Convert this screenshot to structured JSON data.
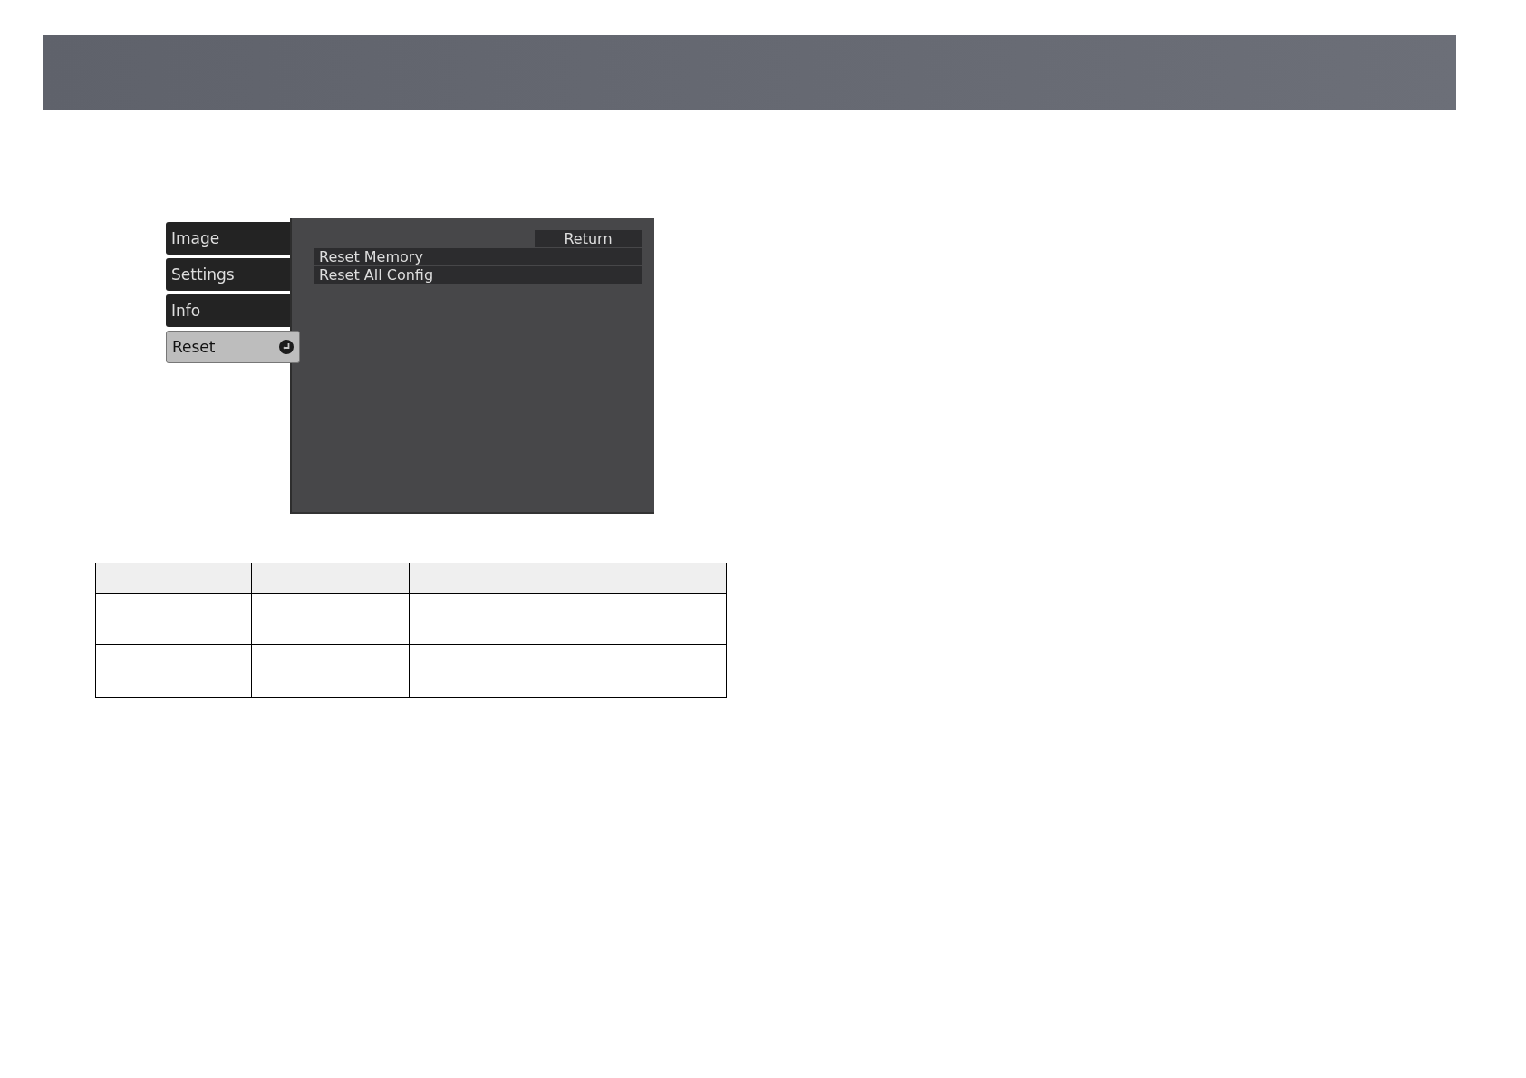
{
  "menu": {
    "tabs": [
      {
        "label": "Image",
        "selected": false
      },
      {
        "label": "Settings",
        "selected": false
      },
      {
        "label": "Info",
        "selected": false
      },
      {
        "label": "Reset",
        "selected": true
      }
    ],
    "return_label": "Return",
    "items": [
      "Reset Memory",
      "Reset All Config"
    ]
  }
}
